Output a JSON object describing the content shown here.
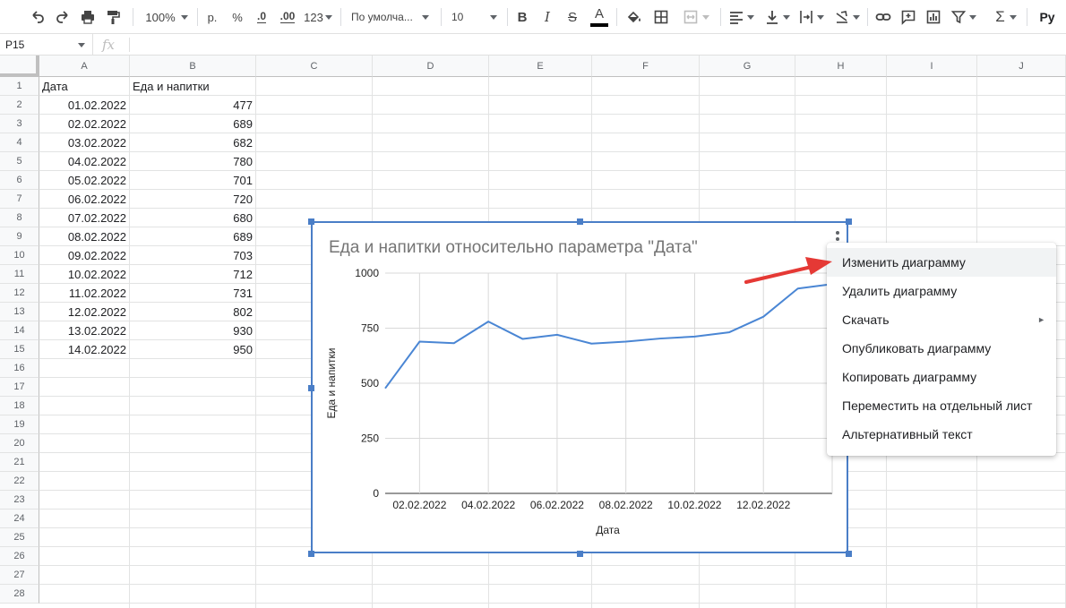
{
  "toolbar": {
    "zoom": "100%",
    "currency": "р.",
    "percent": "%",
    "decrease_decimals": ".0",
    "increase_decimals": ".00",
    "more_formats": "123",
    "font": "По умолча...",
    "font_size": "10",
    "bold": "B",
    "italic": "I",
    "strike": "S",
    "text_color_letter": "A",
    "text_color": "#000000",
    "input_tools": "Ру"
  },
  "formula_bar": {
    "cell_ref": "P15",
    "fx_label": "fx",
    "formula": ""
  },
  "sheet": {
    "columns": [
      "A",
      "B",
      "C",
      "D",
      "E",
      "F",
      "G",
      "H",
      "I",
      "J"
    ],
    "row_numbers": [
      "1",
      "2",
      "3",
      "4",
      "5",
      "6",
      "7",
      "8",
      "9",
      "10",
      "11",
      "12",
      "13",
      "14",
      "15",
      "16",
      "17",
      "18",
      "19",
      "20",
      "21",
      "22",
      "23",
      "24",
      "25",
      "26",
      "27",
      "28"
    ],
    "headers": [
      "Дата",
      "Еда и напитки"
    ],
    "rows": [
      [
        "01.02.2022",
        "477"
      ],
      [
        "02.02.2022",
        "689"
      ],
      [
        "03.02.2022",
        "682"
      ],
      [
        "04.02.2022",
        "780"
      ],
      [
        "05.02.2022",
        "701"
      ],
      [
        "06.02.2022",
        "720"
      ],
      [
        "07.02.2022",
        "680"
      ],
      [
        "08.02.2022",
        "689"
      ],
      [
        "09.02.2022",
        "703"
      ],
      [
        "10.02.2022",
        "712"
      ],
      [
        "11.02.2022",
        "731"
      ],
      [
        "12.02.2022",
        "802"
      ],
      [
        "13.02.2022",
        "930"
      ],
      [
        "14.02.2022",
        "950"
      ]
    ]
  },
  "chart_data": {
    "type": "line",
    "title": "Еда и напитки относительно параметра \"Дата\"",
    "xlabel": "Дата",
    "ylabel": "Еда и напитки",
    "x": [
      "01.02.2022",
      "02.02.2022",
      "03.02.2022",
      "04.02.2022",
      "05.02.2022",
      "06.02.2022",
      "07.02.2022",
      "08.02.2022",
      "09.02.2022",
      "10.02.2022",
      "11.02.2022",
      "12.02.2022",
      "13.02.2022",
      "14.02.2022"
    ],
    "x_tick_labels": [
      "02.02.2022",
      "04.02.2022",
      "06.02.2022",
      "08.02.2022",
      "10.02.2022",
      "12.02.2022"
    ],
    "y_ticks": [
      "0",
      "250",
      "500",
      "750",
      "1000"
    ],
    "ylim": [
      0,
      1000
    ],
    "grid": true,
    "series": [
      {
        "values": [
          477,
          689,
          682,
          780,
          701,
          720,
          680,
          689,
          703,
          712,
          731,
          802,
          930,
          950
        ],
        "color": "#4a86d4"
      }
    ]
  },
  "menu": {
    "items": [
      {
        "label": "Изменить диаграмму"
      },
      {
        "label": "Удалить диаграмму"
      },
      {
        "label": "Скачать",
        "submenu": "►"
      },
      {
        "label": "Опубликовать диаграмму"
      },
      {
        "label": "Копировать диаграмму"
      },
      {
        "label": "Переместить на отдельный лист"
      },
      {
        "label": "Альтернативный текст"
      }
    ]
  },
  "colors": {
    "selection": "#4a7ec7",
    "annotation_arrow": "#e53935"
  }
}
